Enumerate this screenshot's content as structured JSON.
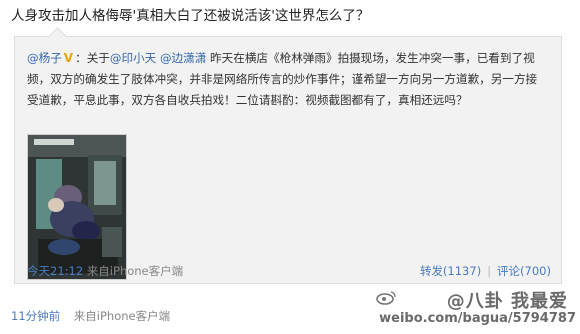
{
  "post": {
    "text": "人身攻击加人格侮辱'真相大白了还被说活该'这世界怎么了？",
    "time": "11分钟前",
    "via": "来自iPhone客户端"
  },
  "repost": {
    "author": "@杨子",
    "verified_badge": "V",
    "prefix": "：关于",
    "mention1": "@印小天",
    "mention2": "@边潇潇",
    "body": " 昨天在横店《枪林弹雨》拍摄现场，发生冲突一事，已看到了视频，双方的确发生了肢体冲突，并非是网络所传言的炒作事件；谨希望一方向另一方道歉，另一方接受道歉，平息此事，双方各自收兵拍戏！二位请斟酌：视频截图都有了，真相还远吗？",
    "time": "今天21:12",
    "via": "来自iPhone客户端",
    "forward": "转发(1137)",
    "comment": "评论(700)"
  },
  "watermark": {
    "line1": "@八卦 我最爱",
    "line2": "weibo.com/bagua/5794787"
  },
  "colors": {
    "link": "#3366aa",
    "footer_link": "#4a7bc0",
    "repost_bg": "#f2f2f2",
    "verified": "#e8a400"
  }
}
